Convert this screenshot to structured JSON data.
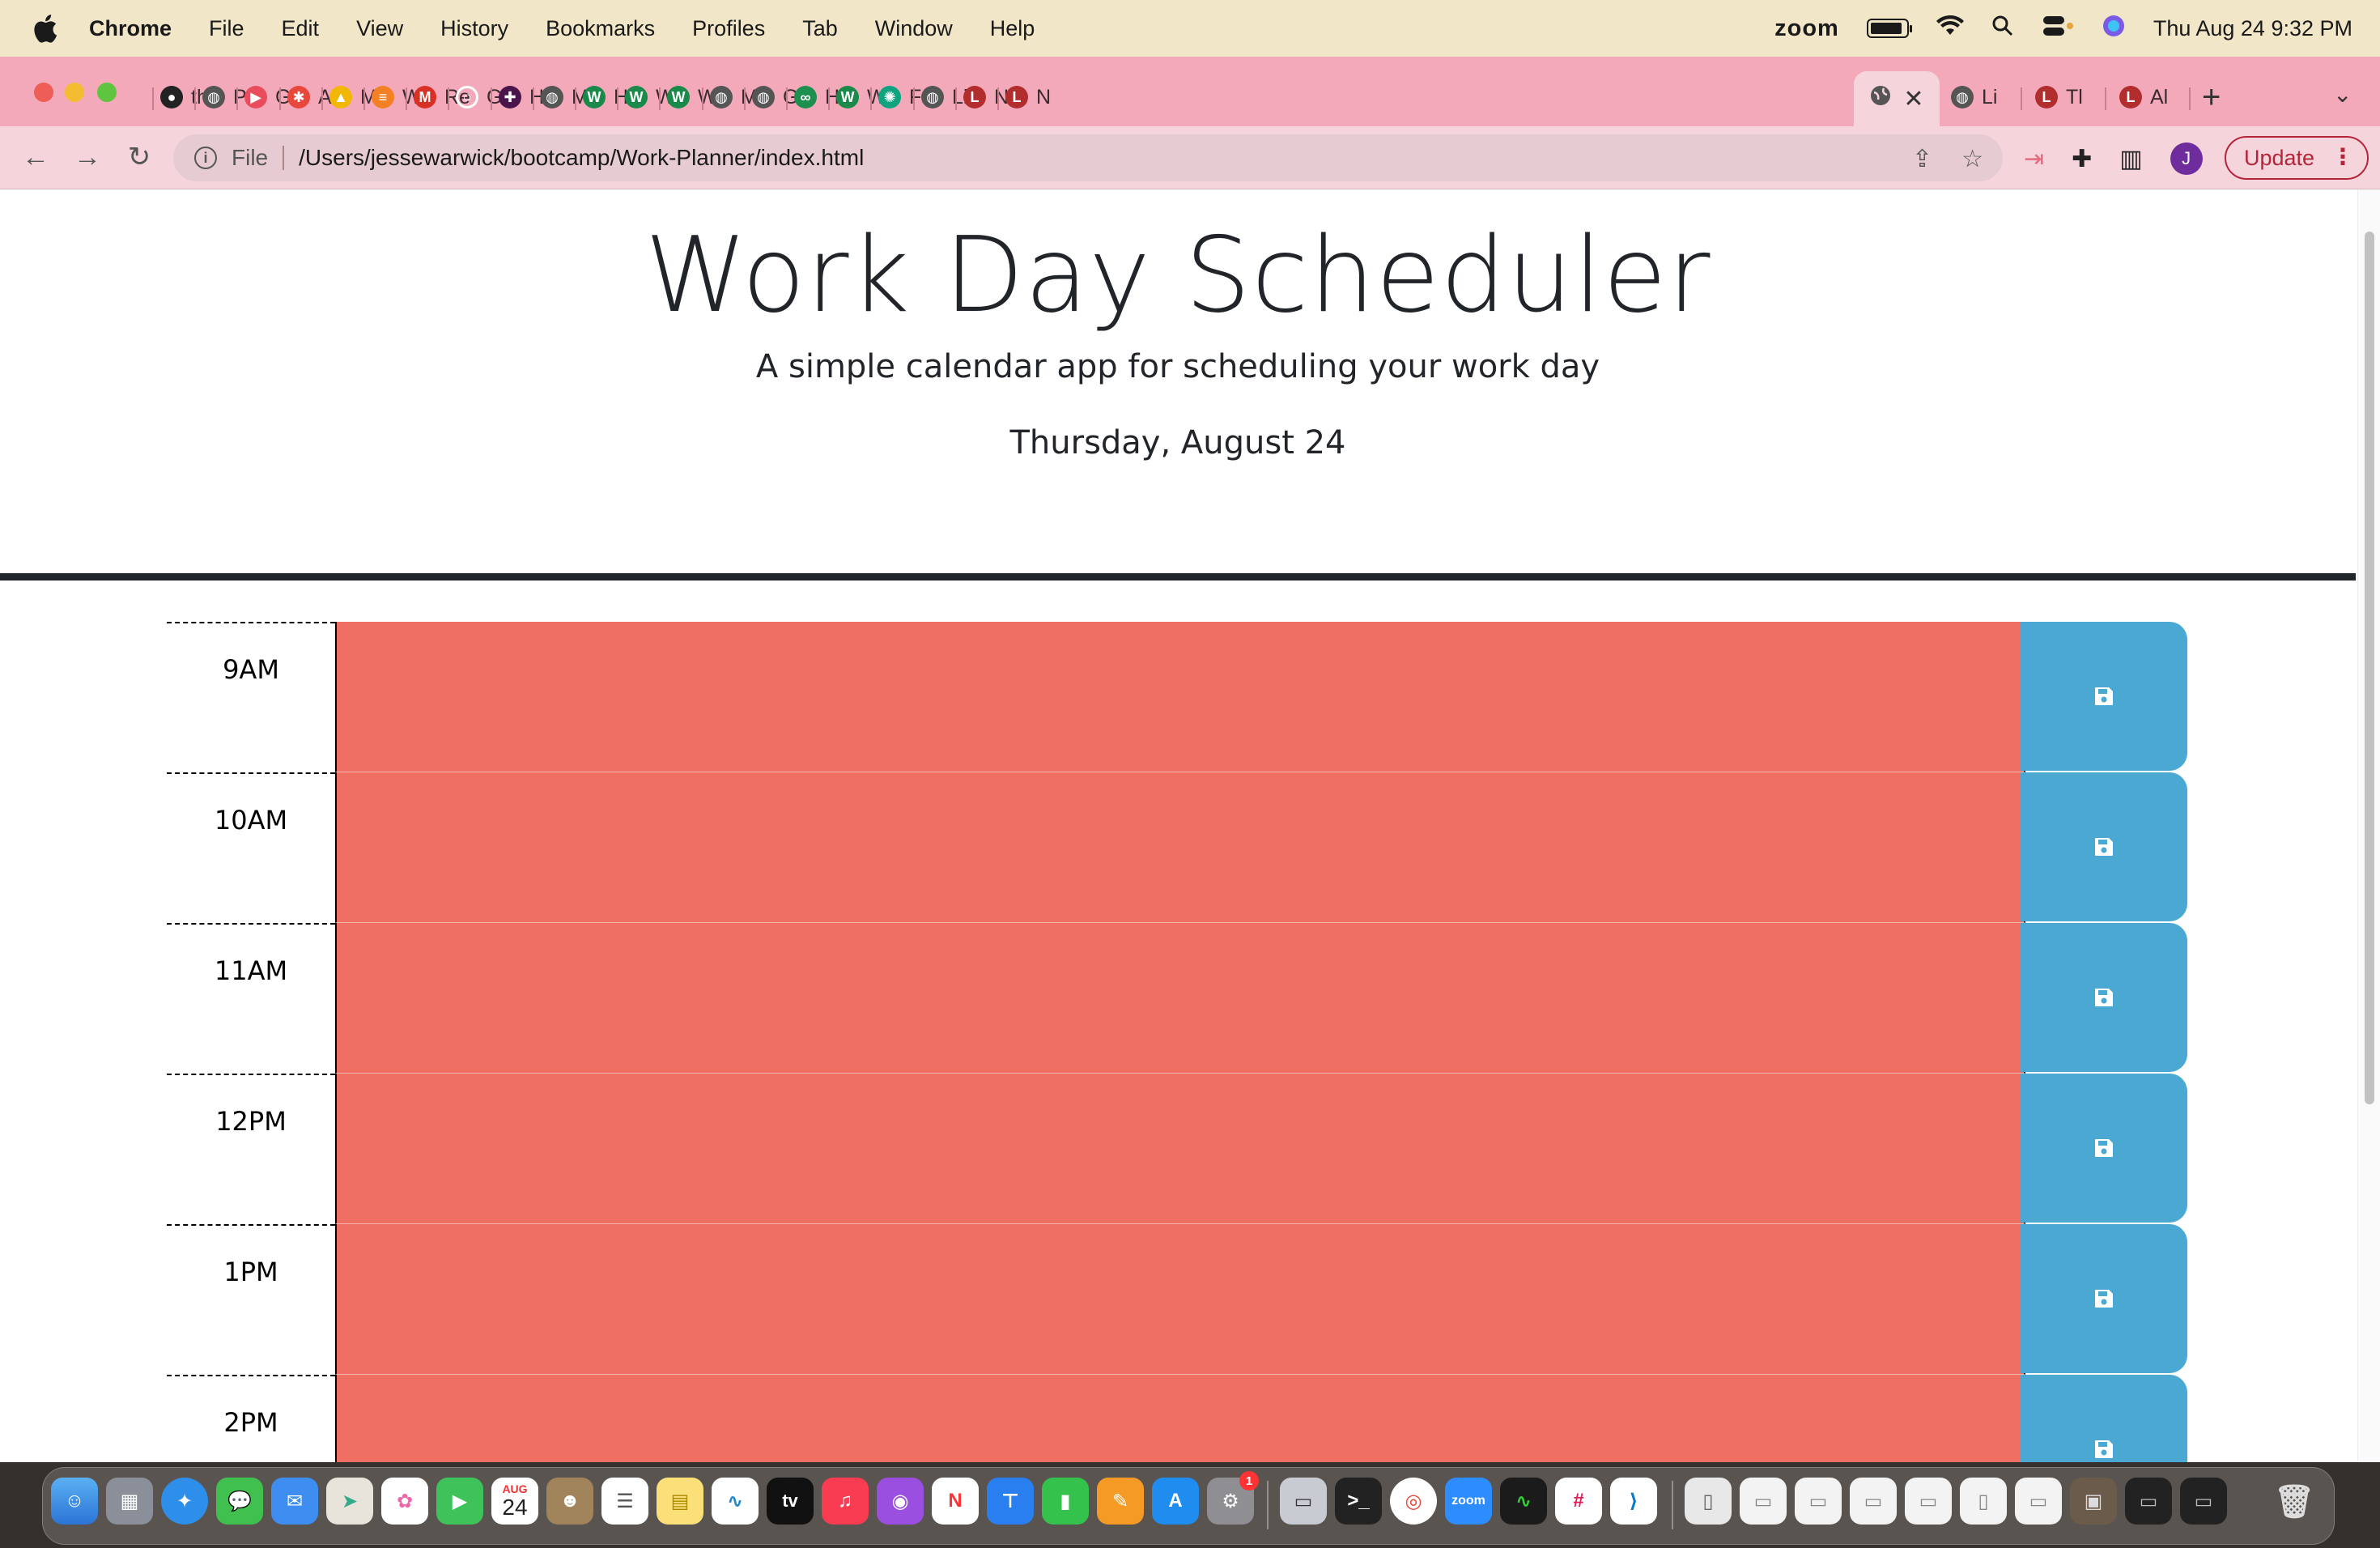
{
  "menubar": {
    "app_name": "Chrome",
    "items": [
      "File",
      "Edit",
      "View",
      "History",
      "Bookmarks",
      "Profiles",
      "Tab",
      "Window",
      "Help"
    ],
    "zoom_label": "zoom",
    "datetime": "Thu Aug 24  9:32 PM"
  },
  "tabs": [
    {
      "label": "th",
      "icon": "github-icon"
    },
    {
      "label": "Pa",
      "icon": "globe-icon"
    },
    {
      "label": "G",
      "icon": "video-icon"
    },
    {
      "label": "A",
      "icon": "asterisk-icon"
    },
    {
      "label": "M",
      "icon": "drive-icon"
    },
    {
      "label": "W",
      "icon": "stack-icon"
    },
    {
      "label": "Re",
      "icon": "gmail-icon"
    },
    {
      "label": "G",
      "icon": "circle-icon"
    },
    {
      "label": "H",
      "icon": "slack-icon"
    },
    {
      "label": "M",
      "icon": "globe-icon"
    },
    {
      "label": "H",
      "icon": "w-icon"
    },
    {
      "label": "W",
      "icon": "w-icon"
    },
    {
      "label": "W",
      "icon": "w-icon"
    },
    {
      "label": "M",
      "icon": "globe-icon"
    },
    {
      "label": "G",
      "icon": "globe-icon"
    },
    {
      "label": "H",
      "icon": "infinity-icon"
    },
    {
      "label": "W",
      "icon": "w-icon"
    },
    {
      "label": "Fe",
      "icon": "openai-icon"
    },
    {
      "label": "Li",
      "icon": "globe-icon"
    },
    {
      "label": "N",
      "icon": "loc-icon"
    },
    {
      "label": "N",
      "icon": "loc-icon"
    }
  ],
  "active_tab": {
    "close": "✕"
  },
  "tabs_after": [
    {
      "label": "Li",
      "icon": "globe-icon"
    },
    {
      "label": "Tl",
      "icon": "loc-icon"
    },
    {
      "label": "Al",
      "icon": "loc-icon"
    }
  ],
  "toolbar": {
    "scheme": "File",
    "url": "/Users/jessewarwick/bootcamp/Work-Planner/index.html",
    "update_label": "Update",
    "profile_initial": "J"
  },
  "page": {
    "title": "Work Day Scheduler",
    "lead": "A simple calendar app for scheduling your work day",
    "current_day": "Thursday, August 24"
  },
  "hours": [
    {
      "label": "9AM",
      "text": ""
    },
    {
      "label": "10AM",
      "text": ""
    },
    {
      "label": "11AM",
      "text": ""
    },
    {
      "label": "12PM",
      "text": ""
    },
    {
      "label": "1PM",
      "text": ""
    },
    {
      "label": "2PM",
      "text": ""
    }
  ],
  "dock": {
    "calendar_month": "AUG",
    "calendar_day": "24",
    "tv_label": "tv",
    "zoom_label": "zoom",
    "settings_badge": "1"
  },
  "colors": {
    "past": "#ef6f63",
    "save": "#4aa8d3",
    "tabstrip": "#f3a9b9",
    "menubar": "#f1e6c8"
  }
}
